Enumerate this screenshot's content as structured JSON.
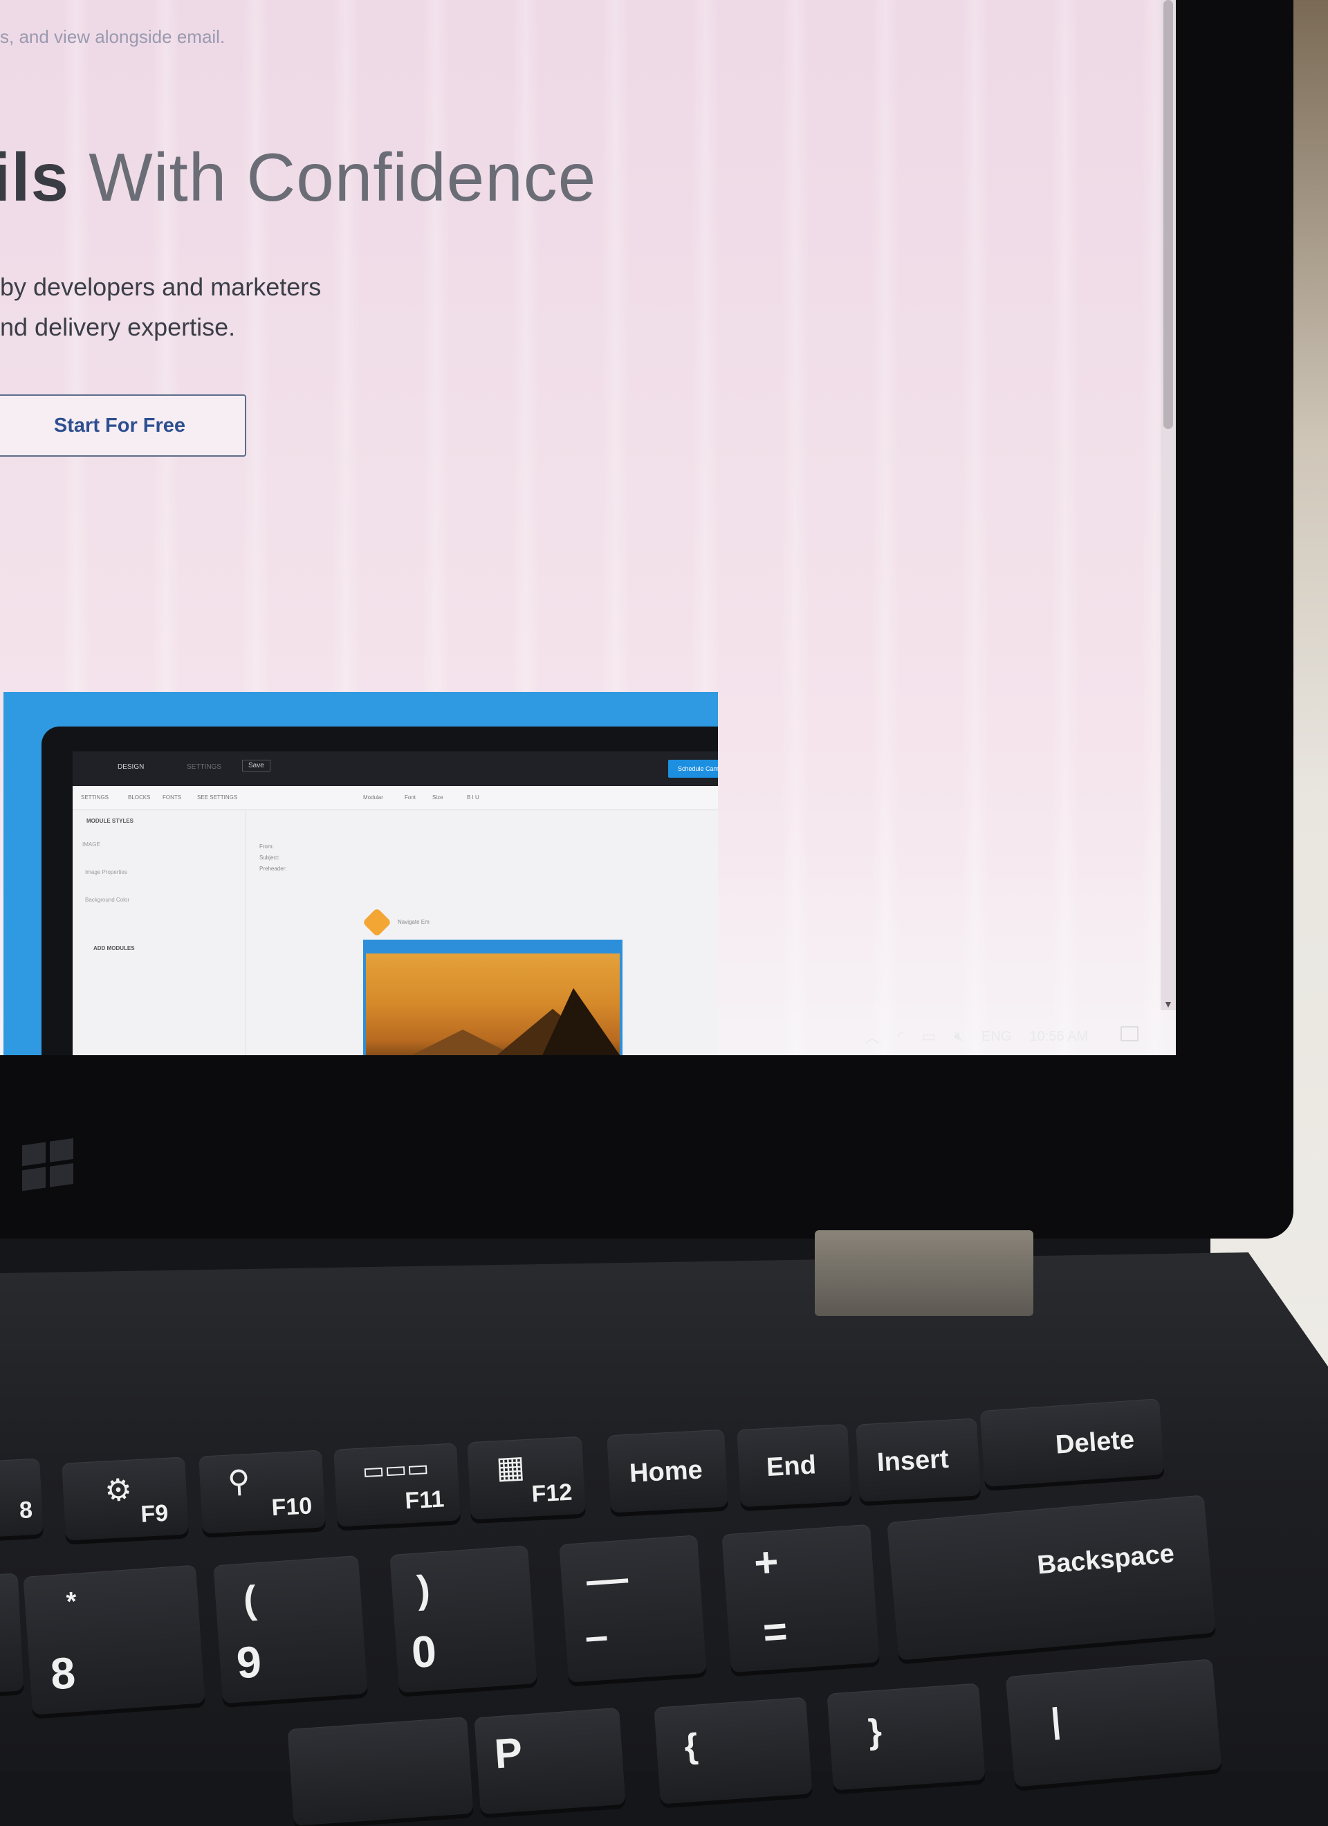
{
  "webpage": {
    "tagline": "s, and view alongside email.",
    "hero_bold": "ils",
    "hero_rest": " With Confidence",
    "subtitle_line1": "by developers and marketers",
    "subtitle_line2": "nd delivery expertise.",
    "cta_label": "Start For Free"
  },
  "preview_app": {
    "tabs": {
      "design": "DESIGN",
      "settings": "SETTINGS",
      "save": "Save"
    },
    "schedule_label": "Schedule Campaign",
    "toolbar": [
      "SETTINGS",
      "BLOCKS",
      "FONTS",
      "SEE SETTINGS",
      "Modular",
      "Font",
      "Size",
      "B I U"
    ],
    "sidebar": {
      "module_styles": "MODULE STYLES",
      "image": "IMAGE",
      "image_properties": "Image Properties",
      "background_color": "Background Color",
      "add_modules": "ADD MODULES"
    },
    "from_lines": [
      "From: ",
      "Subject: ",
      "Preheader: "
    ],
    "sender_name": "Navigate Em"
  },
  "taskbar": {
    "language": "ENG",
    "time": "10:56 AM",
    "icons": [
      "chevron-up-icon",
      "wifi-icon",
      "battery-icon",
      "volume-muted-icon"
    ]
  },
  "keyboard": {
    "fn_row": [
      {
        "label": "F9",
        "icon": "gear-icon"
      },
      {
        "label": "F10",
        "icon": "search-icon"
      },
      {
        "label": "F11",
        "icon": "windows-icon"
      },
      {
        "label": "F12",
        "icon": "grid-icon"
      },
      {
        "label": "Home"
      },
      {
        "label": "End"
      },
      {
        "label": "Insert"
      },
      {
        "label": "Delete"
      }
    ],
    "num_row": [
      {
        "top": "*",
        "bottom": "8"
      },
      {
        "top": "(",
        "bottom": "9"
      },
      {
        "top": ")",
        "bottom": "0"
      },
      {
        "top": "—",
        "bottom": "–"
      },
      {
        "top": "+",
        "bottom": "="
      },
      {
        "label": "Backspace"
      }
    ],
    "bottom_row": [
      "P",
      "{",
      "}",
      "|"
    ],
    "edge_key": "8"
  },
  "colors": {
    "accent_blue": "#2f9ae2",
    "cta_text": "#2e4f8f",
    "hero_text": "#4a4d56"
  }
}
